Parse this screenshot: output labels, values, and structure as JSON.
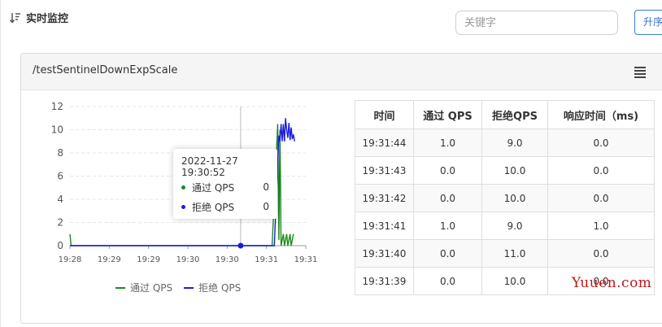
{
  "header": {
    "title": "实时监控",
    "sort_icon": "sort-desc-icon"
  },
  "search": {
    "placeholder": "关键字"
  },
  "toolbar": {
    "sort_label": "升序"
  },
  "panel": {
    "title": "/testSentinelDownExpScale",
    "menu_icon": "hamburger-menu-icon"
  },
  "tooltip": {
    "date": "2022-11-27 19:30:52",
    "rows": [
      {
        "name": "通过 QPS",
        "value": "0",
        "color": "#1b8a1b"
      },
      {
        "name": "拒绝 QPS",
        "value": "0",
        "color": "#1c1cdc"
      }
    ]
  },
  "legend": {
    "items": [
      {
        "name": "通过 QPS",
        "color": "#1b8a1b"
      },
      {
        "name": "拒绝 QPS",
        "color": "#1c1cdc"
      }
    ]
  },
  "table": {
    "headers": [
      "时间",
      "通过 QPS",
      "拒绝QPS",
      "响应时间（ms)"
    ],
    "rows": [
      [
        "19:31:44",
        "1.0",
        "9.0",
        "0.0"
      ],
      [
        "19:31:43",
        "0.0",
        "10.0",
        "0.0"
      ],
      [
        "19:31:42",
        "0.0",
        "10.0",
        "0.0"
      ],
      [
        "19:31:41",
        "1.0",
        "9.0",
        "1.0"
      ],
      [
        "19:31:40",
        "0.0",
        "11.0",
        "0.0"
      ],
      [
        "19:31:39",
        "0.0",
        "10.0",
        "0.0"
      ]
    ]
  },
  "watermark": "Yuuen.com",
  "chart_data": {
    "type": "line",
    "x_ticks": [
      "19:28",
      "19:29",
      "19:29",
      "19:30",
      "19:30",
      "19:31",
      "19:31"
    ],
    "y_ticks": [
      0,
      2,
      4,
      6,
      8,
      10,
      12
    ],
    "ylim": [
      0,
      12
    ],
    "xlim_seconds": [
      0,
      210
    ],
    "grid": true,
    "legend_placement": "bottom",
    "hover_x_seconds": 152,
    "series": [
      {
        "name": "通过 QPS",
        "color": "#1b8a1b",
        "points": [
          [
            0,
            1
          ],
          [
            1,
            0
          ],
          [
            180,
            0
          ],
          [
            185,
            10.5
          ],
          [
            186,
            0.5
          ],
          [
            187,
            10
          ],
          [
            188,
            0
          ],
          [
            190,
            1
          ],
          [
            191,
            0
          ],
          [
            193,
            1
          ],
          [
            194,
            0
          ],
          [
            196,
            1
          ],
          [
            197,
            0
          ],
          [
            199,
            1
          ]
        ]
      },
      {
        "name": "拒绝 QPS",
        "color": "#1c1cdc",
        "points": [
          [
            0,
            0
          ],
          [
            180,
            0
          ],
          [
            182,
            0
          ],
          [
            186,
            9.5
          ],
          [
            187,
            9
          ],
          [
            188,
            10.5
          ],
          [
            189,
            9
          ],
          [
            190,
            10.5
          ],
          [
            191,
            9
          ],
          [
            192,
            11
          ],
          [
            193,
            10
          ],
          [
            194,
            9.3
          ],
          [
            195,
            10.6
          ],
          [
            196,
            9.1
          ],
          [
            197,
            10.2
          ],
          [
            198,
            9.2
          ],
          [
            199,
            9.6
          ],
          [
            200,
            9
          ]
        ]
      }
    ]
  }
}
